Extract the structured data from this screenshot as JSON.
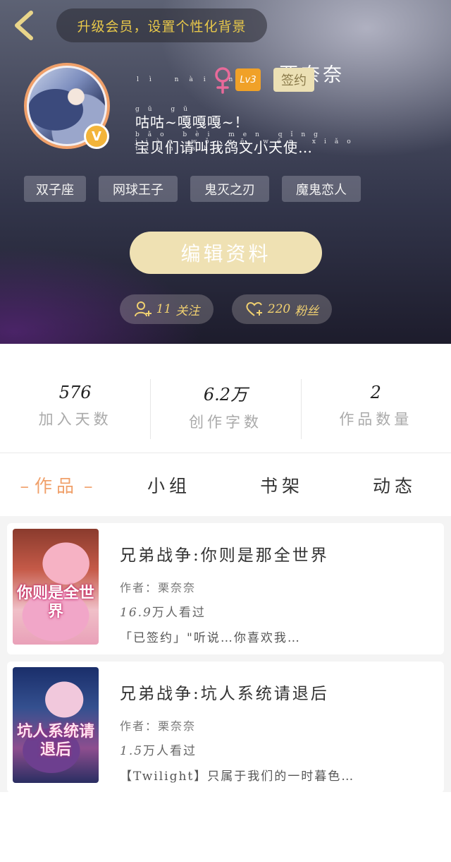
{
  "header": {
    "banner": "升级会员，设置个性化背景",
    "username": "栗奈奈",
    "username_pinyin": "lì nài nài",
    "level": "Lv3",
    "signed_badge": "签约",
    "bio_line1_pinyin": "gū gū",
    "bio_line1": "咕咕~嘎嘎嘎~！",
    "bio_line2_pinyin": "bǎo bèi men qǐng jiào wǒ gē wén xiǎo tiān shǐ",
    "bio_line2": "宝贝们请叫我鸽文小天使…",
    "tags": [
      "双子座",
      "网球王子",
      "鬼灭之刃",
      "魔鬼恋人"
    ],
    "edit_button": "编辑资料",
    "follow": {
      "count": "11",
      "label": "关注"
    },
    "fans": {
      "count": "220",
      "label": "粉丝"
    }
  },
  "stats": [
    {
      "value": "576",
      "label": "加入天数"
    },
    {
      "value": "6.2万",
      "label": "创作字数"
    },
    {
      "value": "2",
      "label": "作品数量"
    }
  ],
  "tabs": [
    {
      "label": "作品",
      "active": true
    },
    {
      "label": "小组",
      "active": false
    },
    {
      "label": "书架",
      "active": false
    },
    {
      "label": "动态",
      "active": false
    }
  ],
  "books": [
    {
      "cover_text": "你则是全世界",
      "title": "兄弟战争:你则是那全世界",
      "author": "作者：栗奈奈",
      "reads_num": "16.9",
      "reads_label": "万人看过",
      "desc": "「已签约」\"听说…你喜欢我…"
    },
    {
      "cover_text": "坑人系统请退后",
      "title": "兄弟战争:坑人系统请退后",
      "author": "作者：栗奈奈",
      "reads_num": "1.5",
      "reads_label": "万人看过",
      "desc": "【Twilight】只属于我们的一时暮色…"
    }
  ],
  "colors": {
    "accent": "#f0a06a",
    "gold": "#f0d070",
    "edit_button_bg": "#efe1b3",
    "level_badge": "#f0a128"
  },
  "icons": [
    "back-icon",
    "female-icon",
    "vip-icon",
    "add-user-icon",
    "heart-plus-icon"
  ]
}
